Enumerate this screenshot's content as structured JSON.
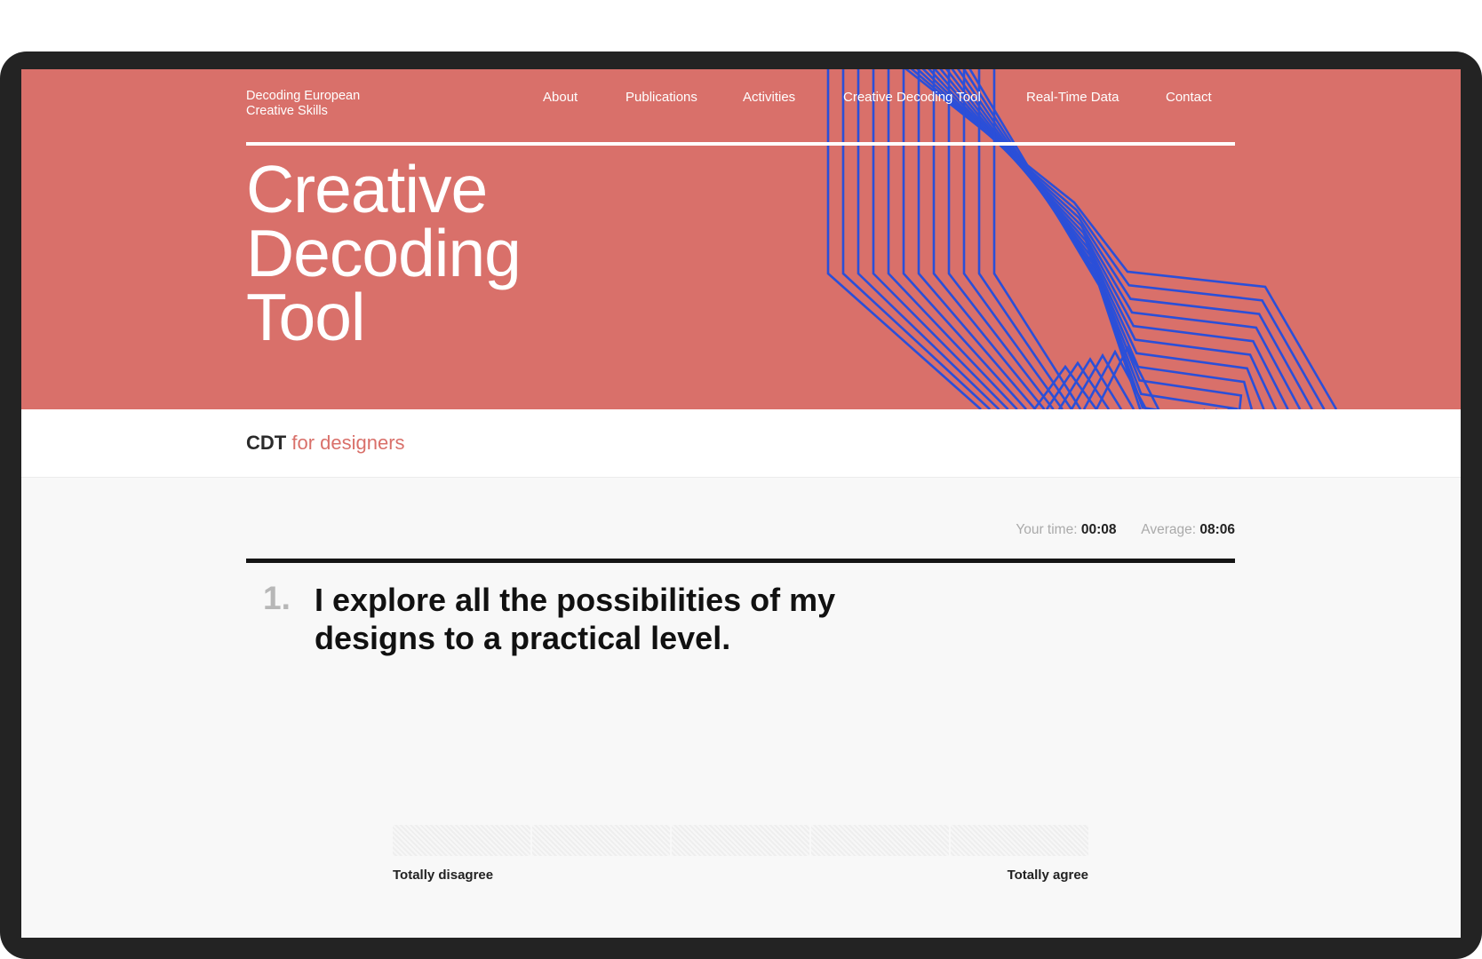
{
  "brand": {
    "line1": "Decoding European",
    "line2": "Creative Skills"
  },
  "nav": {
    "items": [
      {
        "label": "About"
      },
      {
        "label": "Publications"
      },
      {
        "label": "Activities"
      },
      {
        "label": "Creative Decoding Tool"
      },
      {
        "label": "Real-Time Data"
      },
      {
        "label": "Contact"
      }
    ]
  },
  "hero": {
    "title_line1": "Creative",
    "title_line2": "Decoding",
    "title_line3": "Tool",
    "background_color": "#d9706a",
    "art_line_color": "#2b4fd8"
  },
  "subbar": {
    "strong": "CDT",
    "accent": "for designers"
  },
  "timer": {
    "your_time_label": "Your time:",
    "your_time_value": "00:08",
    "average_label": "Average:",
    "average_value": "08:06"
  },
  "question": {
    "number": "1.",
    "text": "I explore all the possibilities of my designs to a practical level."
  },
  "scale": {
    "option_count": 5,
    "min_label": "Totally disagree",
    "max_label": "Totally agree"
  }
}
